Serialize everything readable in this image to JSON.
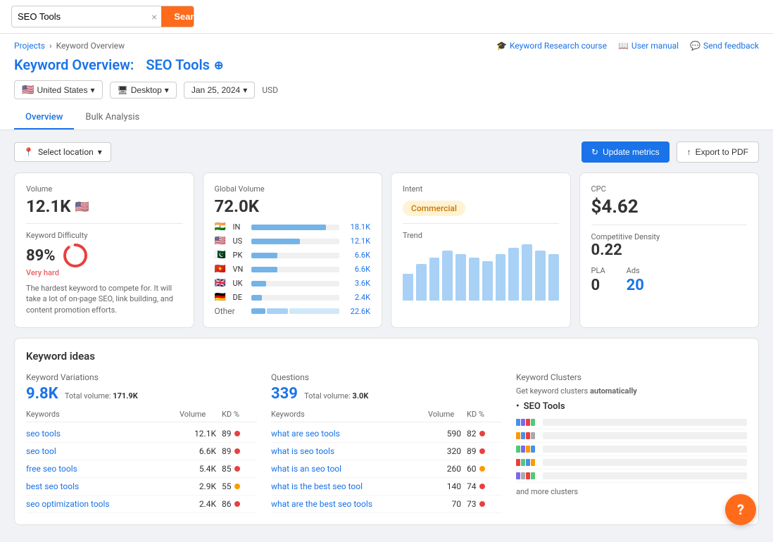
{
  "topbar": {
    "search_value": "SEO Tools",
    "search_btn": "Search",
    "clear_btn": "×"
  },
  "header": {
    "breadcrumb_projects": "Projects",
    "breadcrumb_sep": "›",
    "breadcrumb_page": "Keyword Overview",
    "page_title_prefix": "Keyword Overview:",
    "page_title_keyword": "SEO Tools",
    "links": {
      "course": "Keyword Research course",
      "manual": "User manual",
      "feedback": "Send feedback"
    },
    "filters": {
      "country": "United States",
      "device": "Desktop",
      "date": "Jan 25, 2024",
      "currency": "USD"
    },
    "tabs": [
      "Overview",
      "Bulk Analysis"
    ]
  },
  "toolbar": {
    "select_location": "Select location",
    "update_btn": "Update metrics",
    "export_btn": "Export to PDF"
  },
  "volume_card": {
    "label": "Volume",
    "value": "12.1K"
  },
  "kd_card": {
    "label": "Keyword Difficulty",
    "value": "89%",
    "rating": "Very hard",
    "desc": "The hardest keyword to compete for. It will take a lot of on-page SEO, link building, and content promotion efforts.",
    "pct": 89
  },
  "global_card": {
    "label": "Global Volume",
    "value": "72.0K",
    "countries": [
      {
        "flag": "🇮🇳",
        "code": "IN",
        "value": "18.1K",
        "pct": 85
      },
      {
        "flag": "🇺🇸",
        "code": "US",
        "value": "12.1K",
        "pct": 55
      },
      {
        "flag": "🇵🇰",
        "code": "PK",
        "value": "6.6K",
        "pct": 30
      },
      {
        "flag": "🇻🇳",
        "code": "VN",
        "value": "6.6K",
        "pct": 30
      },
      {
        "flag": "🇬🇧",
        "code": "UK",
        "value": "3.6K",
        "pct": 17
      },
      {
        "flag": "🇩🇪",
        "code": "DE",
        "value": "2.4K",
        "pct": 12
      }
    ],
    "other_label": "Other",
    "other_value": "22.6K"
  },
  "intent_card": {
    "label": "Intent",
    "badge": "Commercial"
  },
  "trend_card": {
    "label": "Trend",
    "bars": [
      40,
      55,
      65,
      75,
      70,
      65,
      60,
      70,
      80,
      85,
      75,
      70
    ]
  },
  "cpc_card": {
    "label": "CPC",
    "value": "$4.62",
    "comp_label": "Competitive Density",
    "comp_value": "0.22",
    "pla_label": "PLA",
    "pla_value": "0",
    "ads_label": "Ads",
    "ads_value": "20"
  },
  "keyword_ideas": {
    "title": "Keyword ideas",
    "variations": {
      "label": "Keyword Variations",
      "count": "9.8K",
      "total_label": "Total volume:",
      "total_value": "171.9K",
      "col_keywords": "Keywords",
      "col_volume": "Volume",
      "col_kd": "KD %",
      "rows": [
        {
          "kw": "seo tools",
          "vol": "12.1K",
          "kd": 89,
          "dot": "red"
        },
        {
          "kw": "seo tool",
          "vol": "6.6K",
          "kd": 89,
          "dot": "red"
        },
        {
          "kw": "free seo tools",
          "vol": "5.4K",
          "kd": 85,
          "dot": "red"
        },
        {
          "kw": "best seo tools",
          "vol": "2.9K",
          "kd": 55,
          "dot": "orange"
        },
        {
          "kw": "seo optimization tools",
          "vol": "2.4K",
          "kd": 86,
          "dot": "red"
        }
      ]
    },
    "questions": {
      "label": "Questions",
      "count": "339",
      "total_label": "Total volume:",
      "total_value": "3.0K",
      "col_keywords": "Keywords",
      "col_volume": "Volume",
      "col_kd": "KD %",
      "rows": [
        {
          "kw": "what are seo tools",
          "vol": "590",
          "kd": 82,
          "dot": "red"
        },
        {
          "kw": "what is seo tools",
          "vol": "320",
          "kd": 89,
          "dot": "red"
        },
        {
          "kw": "what is an seo tool",
          "vol": "260",
          "kd": 60,
          "dot": "orange"
        },
        {
          "kw": "what is the best seo tool",
          "vol": "140",
          "kd": 74,
          "dot": "red"
        },
        {
          "kw": "what are the best seo tools",
          "vol": "70",
          "kd": 73,
          "dot": "red"
        }
      ]
    },
    "clusters": {
      "label": "Keyword Clusters",
      "auto_text": "Get keyword clusters ",
      "auto_bold": "automatically",
      "cluster_name": "SEO Tools",
      "rows": [
        {
          "colors": [
            "#4a90e2",
            "#7b68ee",
            "#e84040",
            "#50c878"
          ]
        },
        {
          "colors": [
            "#ff9900",
            "#4a90e2",
            "#e84040",
            "#aaa"
          ]
        },
        {
          "colors": [
            "#50c878",
            "#7b68ee",
            "#ff9900",
            "#4a90e2"
          ]
        },
        {
          "colors": [
            "#e84040",
            "#50c878",
            "#4a90e2",
            "#ff9900"
          ]
        },
        {
          "colors": [
            "#7b68ee",
            "#aaa",
            "#e84040",
            "#50c878"
          ]
        }
      ],
      "more": "and more clusters"
    }
  }
}
